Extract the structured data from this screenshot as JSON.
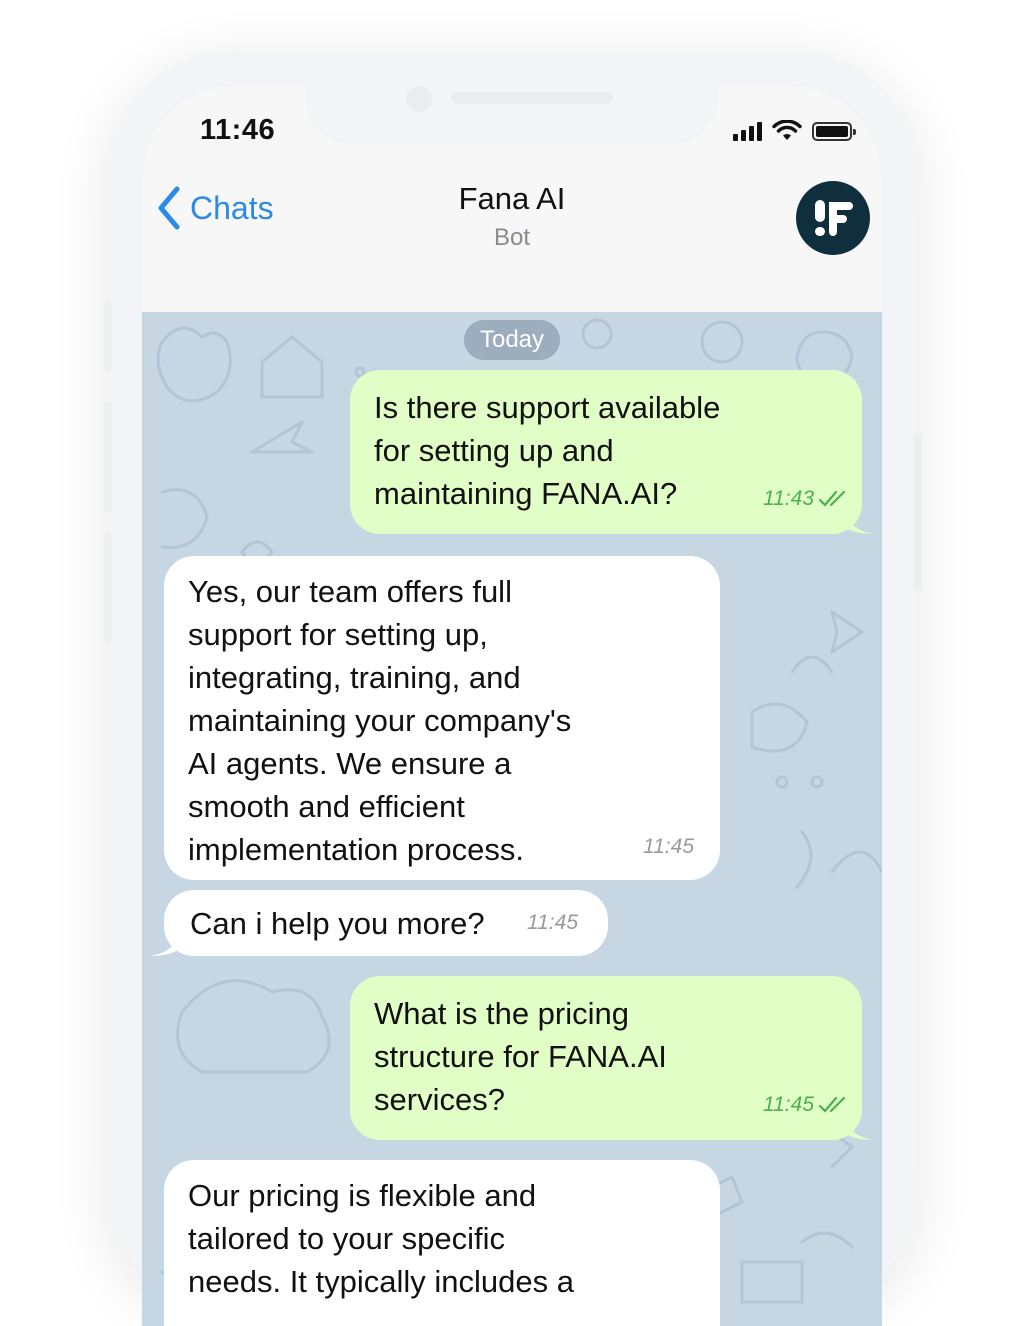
{
  "status_bar": {
    "time": "11:46"
  },
  "nav": {
    "back_label": "Chats",
    "title": "Fana AI",
    "subtitle": "Bot"
  },
  "date_separator": "Today",
  "messages": [
    {
      "direction": "outgoing",
      "text": "Is there support available\nfor setting up and\nmaintaining FANA.AI?",
      "time": "11:43",
      "status": "read"
    },
    {
      "direction": "incoming",
      "text": "Yes, our team offers full\nsupport for setting up,\nintegrating, training, and\nmaintaining your company's\nAI agents. We ensure a\nsmooth and efficient\nimplementation process.",
      "time": "11:45"
    },
    {
      "direction": "incoming",
      "text": "Can i help you more?",
      "time": "11:45"
    },
    {
      "direction": "outgoing",
      "text": "What is the pricing\nstructure for FANA.AI\nservices?",
      "time": "11:45",
      "status": "read"
    },
    {
      "direction": "incoming",
      "text": "Our pricing is flexible and\ntailored to your specific\nneeds. It typically includes a",
      "time": ""
    }
  ],
  "colors": {
    "accent": "#2b8ae6",
    "outgoing_bubble": "#e1fec6",
    "incoming_bubble": "#ffffff",
    "chat_background": "#c7d6e3",
    "read_check": "#4caf50",
    "avatar_bg": "#0f2f3c"
  },
  "icons": {
    "back": "chevron-left-icon",
    "signal": "cellular-signal-icon",
    "wifi": "wifi-icon",
    "battery": "battery-icon",
    "read_status": "double-check-icon",
    "avatar": "fana-logo-icon"
  }
}
